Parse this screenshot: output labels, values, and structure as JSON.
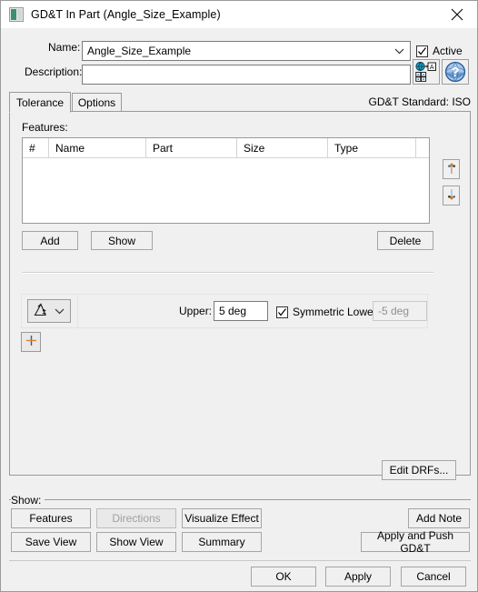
{
  "window": {
    "title": "GD&T In Part (Angle_Size_Example)",
    "icon": "part-icon",
    "close_label": "close-icon"
  },
  "form": {
    "name_label": "Name:",
    "name_value": "Angle_Size_Example",
    "active_label": "Active",
    "active_checked": true,
    "description_label": "Description:",
    "description_value": "",
    "translate_icon": "translate-icon",
    "help_icon": "help-icon"
  },
  "tabs": {
    "items": [
      {
        "label": "Tolerance",
        "active": true
      },
      {
        "label": "Options",
        "active": false
      }
    ],
    "standard_text": "GD&T Standard: ISO"
  },
  "features": {
    "label": "Features:",
    "columns": [
      "#",
      "Name",
      "Part",
      "Size",
      "Type",
      ""
    ],
    "rows": [],
    "move_up_icon": "arrow-up-icon",
    "move_down_icon": "arrow-down-icon",
    "add_label": "Add",
    "show_label": "Show",
    "delete_label": "Delete"
  },
  "tolerance": {
    "symbol_icon": "angularity-symbol-icon",
    "symbol_dropdown_icon": "chevron-down-icon",
    "upper_label": "Upper:",
    "upper_value": "5 deg",
    "symmetric_label": "Symmetric Lower:",
    "symmetric_checked": true,
    "lower_value": "-5 deg",
    "lower_enabled": false,
    "add_row_label": "+"
  },
  "drf": {
    "edit_label": "Edit DRFs..."
  },
  "show_group": {
    "label": "Show:",
    "buttons": [
      {
        "label": "Features",
        "enabled": true
      },
      {
        "label": "Directions",
        "enabled": false
      },
      {
        "label": "Visualize Effect",
        "enabled": true
      },
      {
        "label": "Add Note",
        "enabled": true
      },
      {
        "label": "Save View",
        "enabled": true
      },
      {
        "label": "Show View",
        "enabled": true
      },
      {
        "label": "Summary",
        "enabled": true
      },
      {
        "label": "Apply and Push GD&T",
        "enabled": true
      }
    ]
  },
  "dialog_buttons": {
    "ok": "OK",
    "apply": "Apply",
    "cancel": "Cancel"
  },
  "colors": {
    "window_bg": "#f0f0f0",
    "titlebar_bg": "#ffffff",
    "border": "#9a9a9a",
    "field_bg": "#ffffff",
    "disabled_text": "#8f8f8f",
    "accent_orange": "#e08020",
    "accent_blue": "#4f7fc0",
    "icon_green": "#3e8f6e"
  }
}
